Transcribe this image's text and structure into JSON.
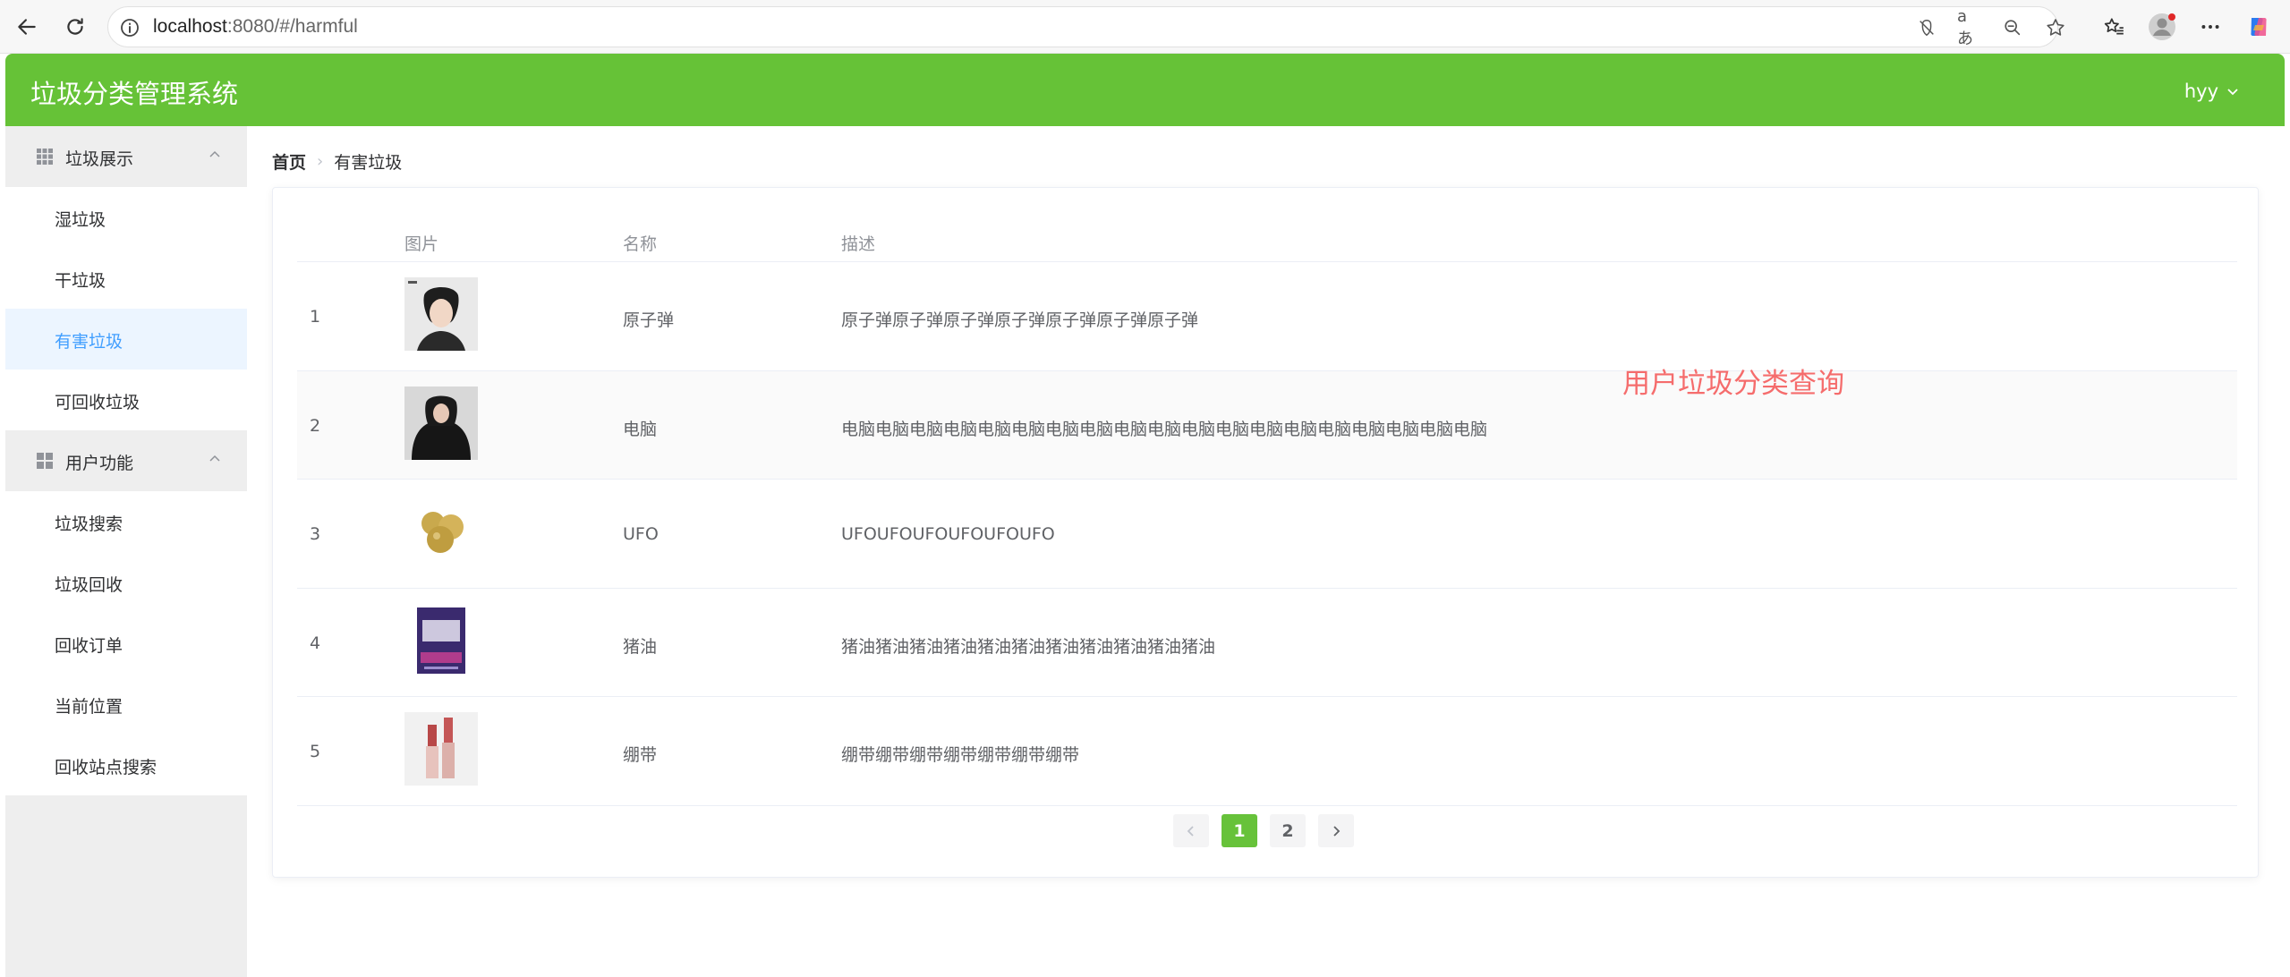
{
  "browser": {
    "url_host": "localhost",
    "url_rest": ":8080/#/harmful"
  },
  "app": {
    "title": "垃圾分类管理系统",
    "user": "hyy"
  },
  "sidebar": {
    "groups": [
      {
        "label": "垃圾展示",
        "items": [
          "湿垃圾",
          "干垃圾",
          "有害垃圾",
          "可回收垃圾"
        ]
      },
      {
        "label": "用户功能",
        "items": [
          "垃圾搜索",
          "垃圾回收",
          "回收订单",
          "当前位置",
          "回收站点搜索"
        ]
      }
    ],
    "active_item": "有害垃圾"
  },
  "breadcrumb": {
    "home": "首页",
    "current": "有害垃圾"
  },
  "table": {
    "columns": [
      "图片",
      "名称",
      "描述"
    ],
    "rows": [
      {
        "index": "1",
        "name": "原子弹",
        "desc": "原子弹原子弹原子弹原子弹原子弹原子弹原子弹"
      },
      {
        "index": "2",
        "name": "电脑",
        "desc": "电脑电脑电脑电脑电脑电脑电脑电脑电脑电脑电脑电脑电脑电脑电脑电脑电脑电脑电脑"
      },
      {
        "index": "3",
        "name": "UFO",
        "desc": "UFOUFOUFOUFOUFOUFO"
      },
      {
        "index": "4",
        "name": "猪油",
        "desc": "猪油猪油猪油猪油猪油猪油猪油猪油猪油猪油猪油"
      },
      {
        "index": "5",
        "name": "绷带",
        "desc": "绷带绷带绷带绷带绷带绷带绷带"
      }
    ]
  },
  "pagination": {
    "pages": [
      "1",
      "2"
    ],
    "current": "1"
  },
  "annotation": "用户垃圾分类查询",
  "colors": {
    "header": "#66c237",
    "active_menu_text": "#409eff",
    "active_menu_bg": "#ecf5ff",
    "pager_active": "#67c23a",
    "annotation": "#f56c6c"
  }
}
